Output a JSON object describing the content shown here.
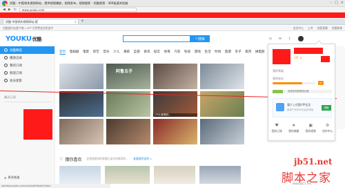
{
  "window": {
    "title": "优酷 - 中国领先视频网站，提供视频播放，视频发布，视频搜索 - 优酷视频 - 360极速浏览器",
    "controls": [
      "–",
      "□",
      "×"
    ]
  },
  "address": {
    "url": "www.youku.com"
  },
  "tabs": [
    {
      "label": "优酷-中国领先视频网站,提",
      "close": "×"
    }
  ],
  "newtab_label": "+",
  "topbar": {
    "left": "优酷国内站客户端  |  18个月免费会员权益中",
    "right": [
      "会员中心",
      "上传",
      "优酷直播",
      "优酷影像"
    ]
  },
  "brand": {
    "logo": "YOUKU",
    "logo_cn": "优酷"
  },
  "search": {
    "button": "搜库"
  },
  "header_icons": [
    "观看记录",
    "消息"
  ],
  "sidebar": {
    "items": [
      {
        "label": "优酷精选",
        "active": true
      },
      {
        "label": "播放记录",
        "active": false
      },
      {
        "label": "我的订阅",
        "active": false
      },
      {
        "label": "频道订阅",
        "active": false
      },
      {
        "label": "会员星影",
        "active": false
      }
    ],
    "subtitle": "最近订阅",
    "more": "更多频道"
  },
  "catnav": [
    "首页",
    "电视剧",
    "电影",
    "综艺",
    "音乐",
    "少儿",
    "来疯",
    "全部",
    "资讯",
    "纪实",
    "体育",
    "汽车",
    "科技",
    "游戏",
    "生活",
    "时尚",
    "旅游",
    "亲子",
    "搞笑",
    "微电影",
    "网剧",
    "拍客",
    "创意视频",
    "自拍"
  ],
  "thumbnails": [
    {
      "caption": ""
    },
    {
      "caption": "",
      "overlay": "阿鲁五子"
    },
    {
      "caption": ""
    },
    {
      "caption": ""
    },
    {
      "caption": ""
    },
    {
      "caption": ""
    },
    {
      "caption": "[TED]邢喜林...",
      "overlay": ""
    },
    {
      "caption": ""
    },
    {
      "caption": ""
    },
    {
      "caption": ""
    },
    {
      "caption": ""
    },
    {
      "caption": ""
    },
    {
      "caption": ""
    },
    {
      "caption": ""
    },
    {
      "caption": ""
    },
    {
      "caption": ""
    }
  ],
  "guess": {
    "title": "猜你喜欢",
    "sub": "这是根据你的观看记录为你推荐的，",
    "link": "查看推荐说明 >"
  },
  "status_url": "window.youku.com/cdn/iwbSbkde/index",
  "popup": {
    "vip": "VIP",
    "label_level": "我的等级",
    "level_val": "",
    "label_growth": "我的成长",
    "growth_pct": 0.7,
    "badge": "V1",
    "step_pct": 0.18,
    "step_txt": "完成任务获得成长值",
    "app_title": "看片上优酷VIP会员",
    "app_sub": "新用户专享30天会员体验",
    "app_btn": "领取",
    "grid": [
      {
        "icon": "♥",
        "label": "我的订阅"
      },
      {
        "icon": "★",
        "label": "我的收藏"
      },
      {
        "icon": "▣",
        "label": "我的视频"
      },
      {
        "icon": "⚙",
        "label": "创作中心"
      }
    ]
  },
  "watermark": {
    "line1": "jb51.net",
    "line2": "脚本之家",
    "line3": "www.jb51.net"
  }
}
